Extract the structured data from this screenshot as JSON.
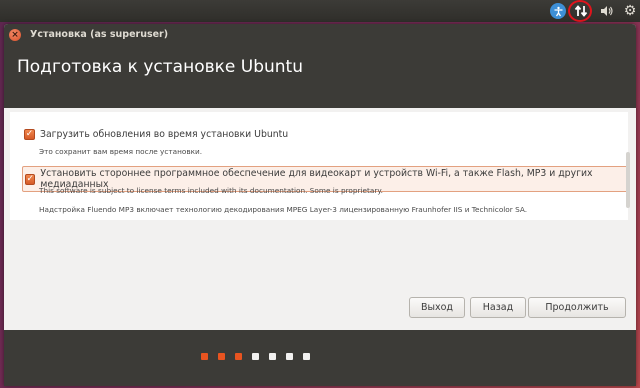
{
  "panel": {
    "icons": [
      "accessibility-icon",
      "network-icon",
      "volume-icon",
      "settings-gear-icon"
    ],
    "highlight_color": "#e0141c"
  },
  "window": {
    "title": "Установка (as superuser)",
    "page_title": "Подготовка к установке Ubuntu"
  },
  "options": {
    "updates": {
      "checked": true,
      "label": "Загрузить обновления во время установки Ubuntu",
      "note": "Это сохранит вам время после установки."
    },
    "third_party": {
      "checked": true,
      "label": "Установить стороннее программное обеспечение для видеокарт и устройств Wi-Fi, а также Flash, MP3 и других медиаданных",
      "note1": "This software is subject to license terms included with its documentation. Some is proprietary.",
      "note2": "Надстройка Fluendo MP3 включает технологию декодирования MPEG Layer-3 лицензированную Fraunhofer IIS и Technicolor SA."
    }
  },
  "buttons": {
    "quit": "Выход",
    "back": "Назад",
    "continue": "Продолжить"
  },
  "progress": {
    "total_steps": 7,
    "completed_steps": 3,
    "active_color": "#e95420",
    "inactive_color": "#f2f1f0"
  }
}
